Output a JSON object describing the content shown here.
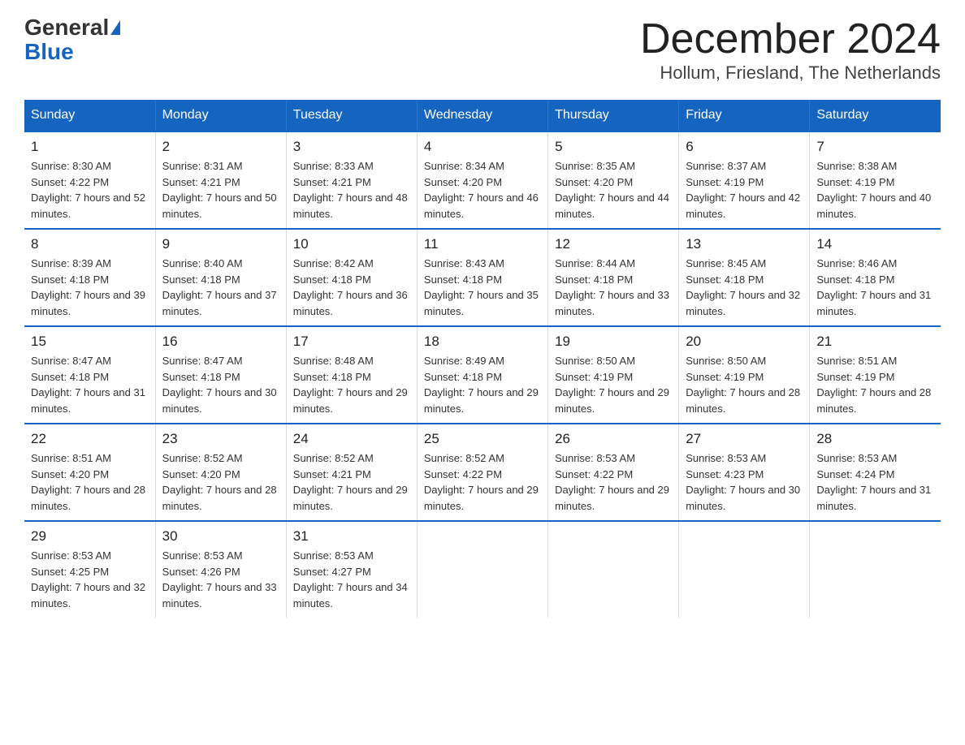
{
  "header": {
    "logo_general": "General",
    "logo_blue": "Blue",
    "month_title": "December 2024",
    "location": "Hollum, Friesland, The Netherlands"
  },
  "weekdays": [
    "Sunday",
    "Monday",
    "Tuesday",
    "Wednesday",
    "Thursday",
    "Friday",
    "Saturday"
  ],
  "weeks": [
    [
      {
        "day": "1",
        "sunrise": "8:30 AM",
        "sunset": "4:22 PM",
        "daylight": "7 hours and 52 minutes."
      },
      {
        "day": "2",
        "sunrise": "8:31 AM",
        "sunset": "4:21 PM",
        "daylight": "7 hours and 50 minutes."
      },
      {
        "day": "3",
        "sunrise": "8:33 AM",
        "sunset": "4:21 PM",
        "daylight": "7 hours and 48 minutes."
      },
      {
        "day": "4",
        "sunrise": "8:34 AM",
        "sunset": "4:20 PM",
        "daylight": "7 hours and 46 minutes."
      },
      {
        "day": "5",
        "sunrise": "8:35 AM",
        "sunset": "4:20 PM",
        "daylight": "7 hours and 44 minutes."
      },
      {
        "day": "6",
        "sunrise": "8:37 AM",
        "sunset": "4:19 PM",
        "daylight": "7 hours and 42 minutes."
      },
      {
        "day": "7",
        "sunrise": "8:38 AM",
        "sunset": "4:19 PM",
        "daylight": "7 hours and 40 minutes."
      }
    ],
    [
      {
        "day": "8",
        "sunrise": "8:39 AM",
        "sunset": "4:18 PM",
        "daylight": "7 hours and 39 minutes."
      },
      {
        "day": "9",
        "sunrise": "8:40 AM",
        "sunset": "4:18 PM",
        "daylight": "7 hours and 37 minutes."
      },
      {
        "day": "10",
        "sunrise": "8:42 AM",
        "sunset": "4:18 PM",
        "daylight": "7 hours and 36 minutes."
      },
      {
        "day": "11",
        "sunrise": "8:43 AM",
        "sunset": "4:18 PM",
        "daylight": "7 hours and 35 minutes."
      },
      {
        "day": "12",
        "sunrise": "8:44 AM",
        "sunset": "4:18 PM",
        "daylight": "7 hours and 33 minutes."
      },
      {
        "day": "13",
        "sunrise": "8:45 AM",
        "sunset": "4:18 PM",
        "daylight": "7 hours and 32 minutes."
      },
      {
        "day": "14",
        "sunrise": "8:46 AM",
        "sunset": "4:18 PM",
        "daylight": "7 hours and 31 minutes."
      }
    ],
    [
      {
        "day": "15",
        "sunrise": "8:47 AM",
        "sunset": "4:18 PM",
        "daylight": "7 hours and 31 minutes."
      },
      {
        "day": "16",
        "sunrise": "8:47 AM",
        "sunset": "4:18 PM",
        "daylight": "7 hours and 30 minutes."
      },
      {
        "day": "17",
        "sunrise": "8:48 AM",
        "sunset": "4:18 PM",
        "daylight": "7 hours and 29 minutes."
      },
      {
        "day": "18",
        "sunrise": "8:49 AM",
        "sunset": "4:18 PM",
        "daylight": "7 hours and 29 minutes."
      },
      {
        "day": "19",
        "sunrise": "8:50 AM",
        "sunset": "4:19 PM",
        "daylight": "7 hours and 29 minutes."
      },
      {
        "day": "20",
        "sunrise": "8:50 AM",
        "sunset": "4:19 PM",
        "daylight": "7 hours and 28 minutes."
      },
      {
        "day": "21",
        "sunrise": "8:51 AM",
        "sunset": "4:19 PM",
        "daylight": "7 hours and 28 minutes."
      }
    ],
    [
      {
        "day": "22",
        "sunrise": "8:51 AM",
        "sunset": "4:20 PM",
        "daylight": "7 hours and 28 minutes."
      },
      {
        "day": "23",
        "sunrise": "8:52 AM",
        "sunset": "4:20 PM",
        "daylight": "7 hours and 28 minutes."
      },
      {
        "day": "24",
        "sunrise": "8:52 AM",
        "sunset": "4:21 PM",
        "daylight": "7 hours and 29 minutes."
      },
      {
        "day": "25",
        "sunrise": "8:52 AM",
        "sunset": "4:22 PM",
        "daylight": "7 hours and 29 minutes."
      },
      {
        "day": "26",
        "sunrise": "8:53 AM",
        "sunset": "4:22 PM",
        "daylight": "7 hours and 29 minutes."
      },
      {
        "day": "27",
        "sunrise": "8:53 AM",
        "sunset": "4:23 PM",
        "daylight": "7 hours and 30 minutes."
      },
      {
        "day": "28",
        "sunrise": "8:53 AM",
        "sunset": "4:24 PM",
        "daylight": "7 hours and 31 minutes."
      }
    ],
    [
      {
        "day": "29",
        "sunrise": "8:53 AM",
        "sunset": "4:25 PM",
        "daylight": "7 hours and 32 minutes."
      },
      {
        "day": "30",
        "sunrise": "8:53 AM",
        "sunset": "4:26 PM",
        "daylight": "7 hours and 33 minutes."
      },
      {
        "day": "31",
        "sunrise": "8:53 AM",
        "sunset": "4:27 PM",
        "daylight": "7 hours and 34 minutes."
      },
      null,
      null,
      null,
      null
    ]
  ]
}
